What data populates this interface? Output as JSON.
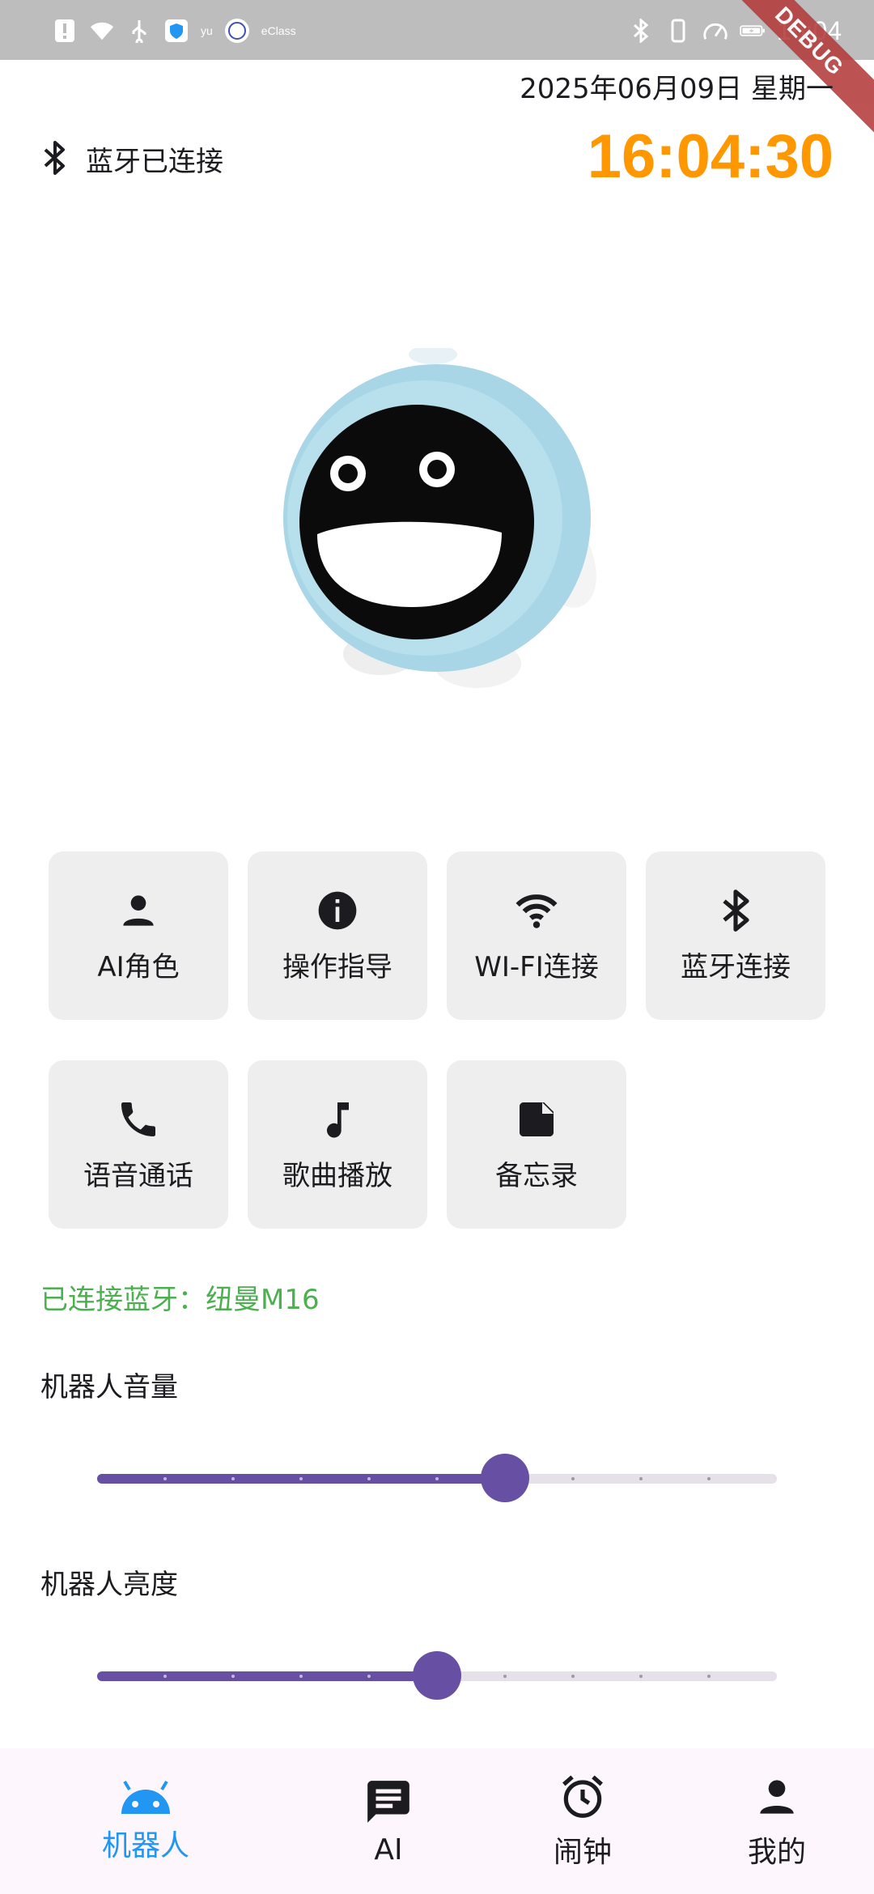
{
  "status_bar": {
    "time": "16:04",
    "carrier_text": "eClass",
    "small_text": "yu",
    "debug_label": "DEBUG"
  },
  "header": {
    "date": "2025年06月09日 星期一",
    "bluetooth_status": "蓝牙已连接",
    "clock": "16:04:30"
  },
  "grid": {
    "items": [
      {
        "label": "AI角色",
        "icon": "person-icon"
      },
      {
        "label": "操作指导",
        "icon": "info-icon"
      },
      {
        "label": "WI-FI连接",
        "icon": "wifi-icon"
      },
      {
        "label": "蓝牙连接",
        "icon": "bluetooth-icon"
      },
      {
        "label": "语音通话",
        "icon": "phone-icon"
      },
      {
        "label": "歌曲播放",
        "icon": "music-note-icon"
      },
      {
        "label": "备忘录",
        "icon": "note-icon"
      }
    ]
  },
  "connected_text": "已连接蓝牙：纽曼M16",
  "volume": {
    "label": "机器人音量",
    "value": 0.6
  },
  "brightness": {
    "label": "机器人亮度",
    "value": 0.5
  },
  "bottom_nav": {
    "items": [
      {
        "label": "机器人",
        "icon": "android-icon",
        "active": true
      },
      {
        "label": "AI",
        "icon": "chat-icon",
        "active": false
      },
      {
        "label": "闹钟",
        "icon": "alarm-icon",
        "active": false
      },
      {
        "label": "我的",
        "icon": "person-icon",
        "active": false
      }
    ]
  },
  "colors": {
    "clock": "#ff9800",
    "connected": "#4caf50",
    "slider_active": "#6750a4",
    "slider_inactive": "#e6e0e9",
    "nav_active": "#2196f3",
    "tile_bg": "#eeeeee"
  }
}
